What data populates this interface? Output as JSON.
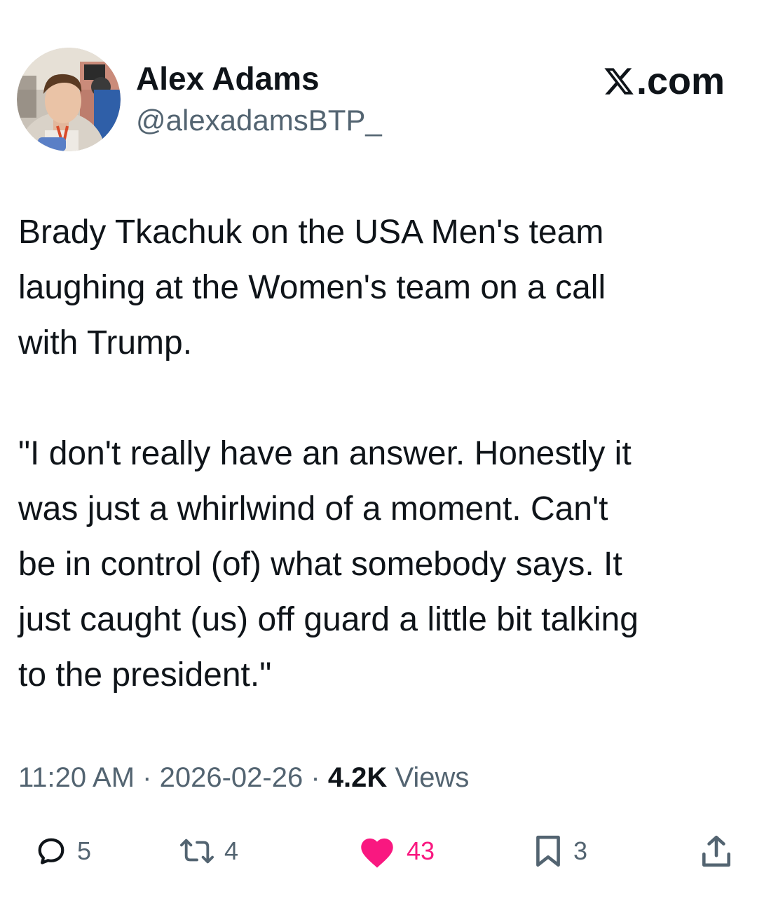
{
  "author": {
    "name": "Alex Adams",
    "handle": "@alexadamsBTP_"
  },
  "brand": {
    "label": ".com",
    "icon": "x-logo-icon"
  },
  "tweet": {
    "paragraphs": [
      "Brady Tkachuk on the USA Men's team\nlaughing at the Women's team on a call\nwith Trump.",
      "\"I don't really have an answer. Honestly it\nwas just a whirlwind of a moment. Can't\nbe in control (of) what somebody says. It\njust caught (us) off guard a little bit talking\nto the president.\""
    ]
  },
  "meta": {
    "time": "11:20 AM",
    "separator": "·",
    "date": "2026-02-26",
    "views_count": "4.2K",
    "views_label": "Views"
  },
  "actions": {
    "reply": {
      "icon": "reply-icon",
      "count": "5"
    },
    "repost": {
      "icon": "repost-icon",
      "count": "4"
    },
    "like": {
      "icon": "heart-icon",
      "count": "43",
      "active": true
    },
    "bookmark": {
      "icon": "bookmark-icon",
      "count": "3"
    },
    "share": {
      "icon": "share-icon"
    }
  },
  "colors": {
    "text_primary": "#0f1419",
    "text_secondary": "#536471",
    "like_active": "#f91880",
    "background": "#ffffff"
  }
}
